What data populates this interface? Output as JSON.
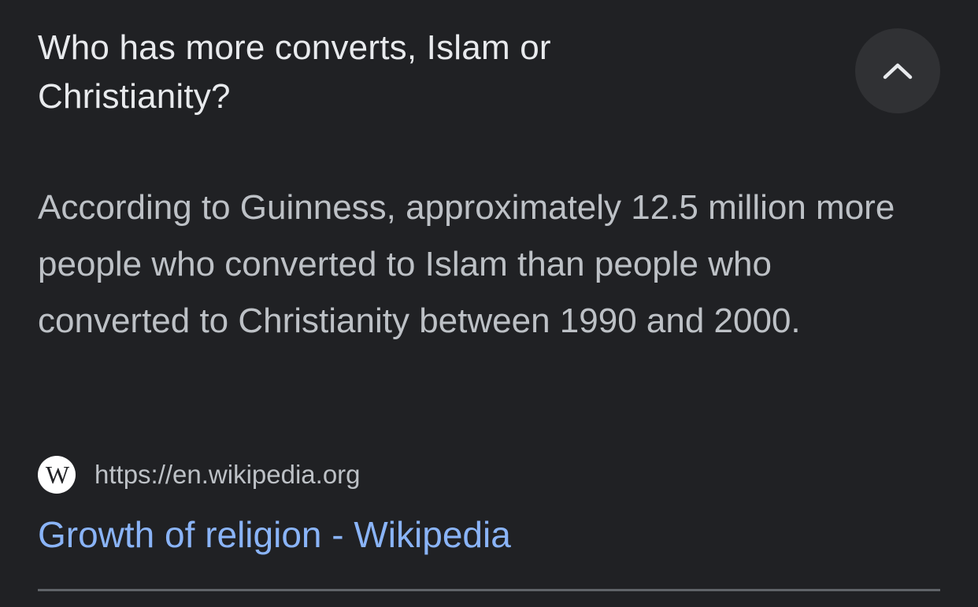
{
  "question": {
    "text": "Who has more converts, Islam or Christianity?"
  },
  "controls": {
    "collapse_icon": "chevron-up-icon"
  },
  "answer": {
    "text": "According to Guinness, approximately 12.5 million more people who converted to Islam than people who converted to Christianity between 1990 and 2000."
  },
  "source": {
    "favicon_letter": "W",
    "url": "https://en.wikipedia.org",
    "title": "Growth of religion - Wikipedia"
  },
  "colors": {
    "background": "#202124",
    "button_background": "#303134",
    "question_text": "#e8eaed",
    "answer_text": "#bdc1c6",
    "link": "#8ab4f8",
    "divider": "#5f6368"
  }
}
